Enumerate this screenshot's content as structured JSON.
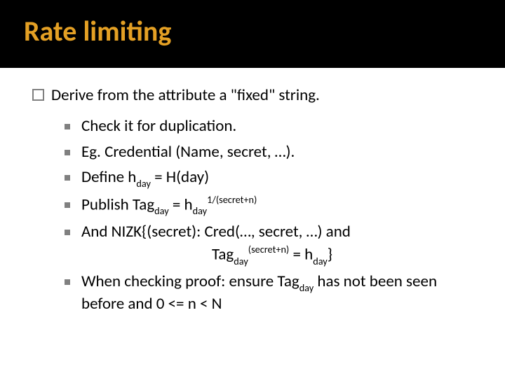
{
  "title": "Rate limiting",
  "main_bullet": "Derive from the attribute a \"fixed\" string.",
  "items": {
    "a": "Check it for duplication.",
    "b": "Eg. Credential (Name, secret, …).",
    "c_pre": "Define h",
    "c_sub1": "day",
    "c_mid": " = H(day)",
    "d_pre": "Publish Tag",
    "d_sub1": "day",
    "d_mid": " = h",
    "d_sub2": "day",
    "d_sup": "1/(secret+n)",
    "e_pre": "And NIZK{(secret):  Cred(…, secret, …) and",
    "e2_pre": "Tag",
    "e2_sub1": "day",
    "e2_sup": "(secret+n)",
    "e2_mid": " = h",
    "e2_sub2": "day",
    "e2_end": "}",
    "f_pre": "When checking proof: ensure Tag",
    "f_sub1": "day",
    "f_mid": " has not been seen before and 0 <= n < N"
  }
}
